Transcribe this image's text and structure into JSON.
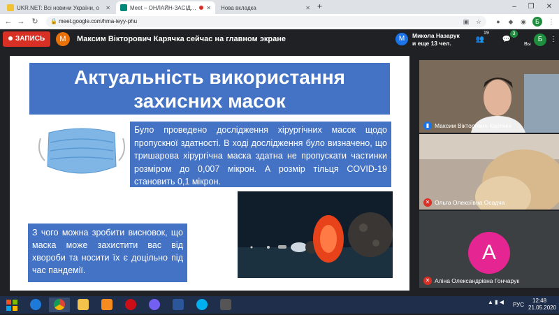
{
  "browser": {
    "tabs": [
      {
        "label": "UKR.NET: Всі новини України, о",
        "active": false,
        "favicon_color": "#f1c232"
      },
      {
        "label": "Meet – ОНЛАЙН-ЗАСІДАНН",
        "active": true,
        "favicon_color": "#00897b"
      },
      {
        "label": "Нова вкладка",
        "active": false,
        "favicon_color": ""
      }
    ],
    "new_tab": "+",
    "url": "meet.google.com/hma-ieyy-phu",
    "profile_initial": "Б"
  },
  "meet": {
    "record_label": "ЗАПИСЬ",
    "presenter_initial": "M",
    "presenting_text": "Максим Вікторович Карячка сейчас на главном экране",
    "participants_line1": "Микола Назарук",
    "participants_line2": "и еще 13 чел.",
    "participants_avatar": "M",
    "people_count": "19",
    "chat_count": "3",
    "user_initial": "Б",
    "user_label": "Вы"
  },
  "slide": {
    "title": "Актуальність використання захисних масок",
    "description": "Було проведено дослідження хірургічних масок щодо пропускної здатності. В ході дослідження було визначено, що тришарова хірургічна маска здатна не пропускати частинки розміром до 0,007 мікрон. А розмір тільця COVID-19 становить 0,1 мікрон.",
    "conclusion": "З чого можна зробити висновок, що маска може захистити вас від хвороби та носити їх є доцільно під час пандемії."
  },
  "participants": [
    {
      "name": "Максим Вікторович Карячка",
      "muted": false
    },
    {
      "name": "Ольга Олексіївна Осадча",
      "muted": true
    },
    {
      "name": "Аліна Олександрівна Гончарук",
      "muted": true,
      "initial": "А",
      "avatar_color": "#e52592"
    }
  ],
  "taskbar": {
    "lang": "РУС",
    "time": "12:48",
    "date": "21.05.2020"
  },
  "colors": {
    "slide_blue": "#4472c4",
    "record_red": "#d93025",
    "meet_bg": "#202124"
  }
}
